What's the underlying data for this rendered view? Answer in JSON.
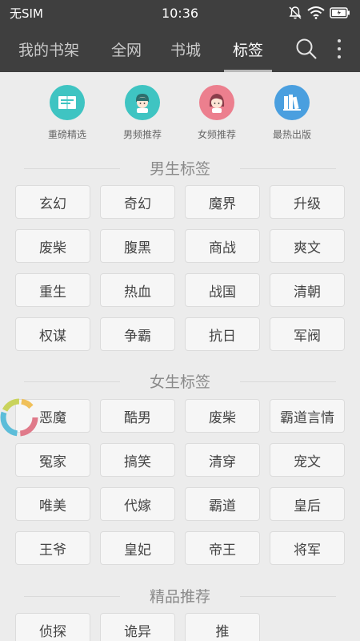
{
  "status_bar": {
    "carrier": "无SIM",
    "time": "10:36"
  },
  "nav": {
    "tabs": [
      {
        "label": "我的书架"
      },
      {
        "label": "全网"
      },
      {
        "label": "书城"
      },
      {
        "label": "标签"
      }
    ],
    "active_tab": "标签"
  },
  "shortcuts": [
    {
      "label": "重磅精选",
      "color": "#3fc4c2",
      "icon": "featured-book-icon"
    },
    {
      "label": "男频推荐",
      "color": "#3fc4c2",
      "icon": "boy-avatar-icon"
    },
    {
      "label": "女频推荐",
      "color": "#ec7f8e",
      "icon": "girl-avatar-icon"
    },
    {
      "label": "最热出版",
      "color": "#4a9fdf",
      "icon": "books-icon"
    }
  ],
  "sections": {
    "male": {
      "title": "男生标签",
      "tags": [
        "玄幻",
        "奇幻",
        "魔界",
        "升级",
        "废柴",
        "腹黑",
        "商战",
        "爽文",
        "重生",
        "热血",
        "战国",
        "清朝",
        "权谋",
        "争霸",
        "抗日",
        "军阀"
      ]
    },
    "female": {
      "title": "女生标签",
      "tags": [
        "恶魔",
        "酷男",
        "废柴",
        "霸道言情",
        "冤家",
        "搞笑",
        "清穿",
        "宠文",
        "唯美",
        "代嫁",
        "霸道",
        "皇后",
        "王爷",
        "皇妃",
        "帝王",
        "将军"
      ]
    },
    "recommend": {
      "title": "精品推荐",
      "tags": [
        "侦探",
        "诡异",
        "推"
      ]
    }
  }
}
